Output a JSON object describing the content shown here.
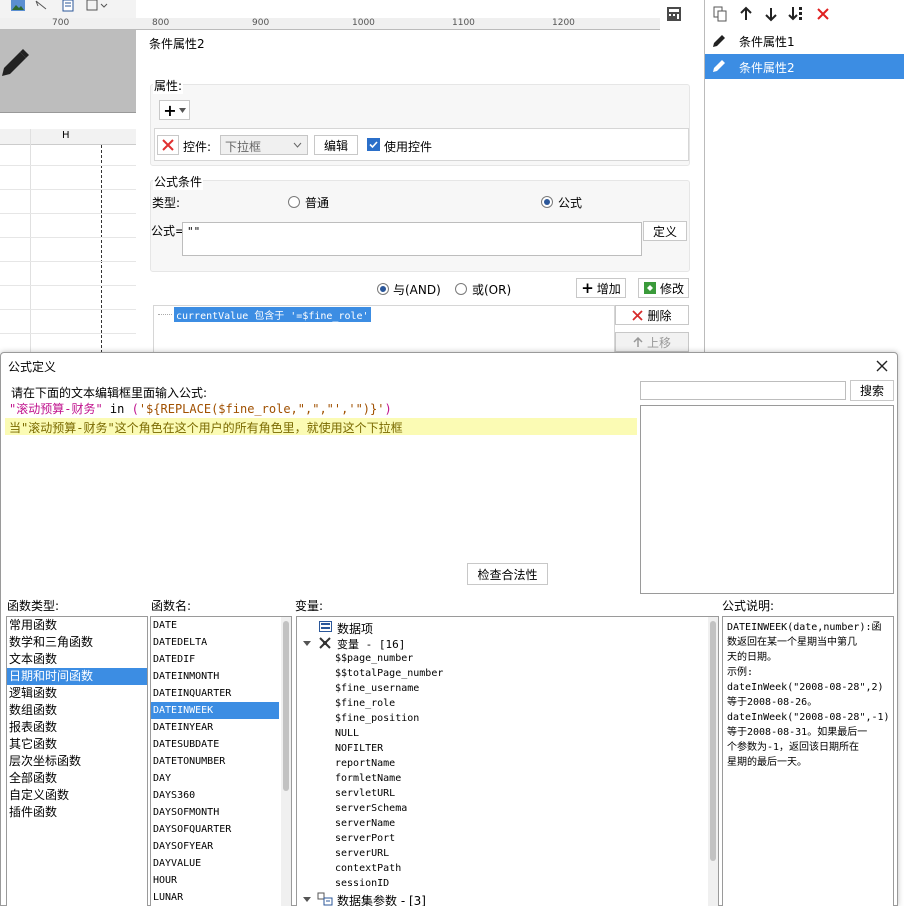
{
  "ruler": {
    "marks": [
      "700",
      "800",
      "900",
      "1000",
      "1100",
      "1200"
    ]
  },
  "sheet": {
    "column_h": "H"
  },
  "cond_panel": {
    "title": "条件属性2",
    "attr_section": "属性:",
    "add_plus": "+",
    "control_label": "控件:",
    "control_select": "下拉框",
    "edit_btn": "编辑",
    "use_control": "使用控件",
    "formula_section": "公式条件",
    "type_label": "类型:",
    "type_normal": "普通",
    "type_formula": "公式",
    "formula_label": "公式=",
    "formula_value": "\"\"",
    "define_btn": "定义",
    "and_label": "与(AND)",
    "or_label": "或(OR)",
    "add_btn": "增加",
    "modify_btn": "修改",
    "condition_item": "currentValue 包含于 '=$fine_role'",
    "delete_btn": "删除",
    "up_btn": "上移"
  },
  "right_panel": {
    "items": [
      "条件属性1",
      "条件属性2"
    ]
  },
  "dialog": {
    "title": "公式定义",
    "instruction": "请在下面的文本编辑框里面输入公式:",
    "line1_str": "\"滚动预算-财务\"",
    "line1_in": " in ",
    "line1_paren": "(",
    "line1_rest": "'${REPLACE($fine_role,\",\",\"','\")}'",
    "line1_close": ")",
    "line2": "当\"滚动预算-财务\"这个角色在这个用户的所有角色里，就使用这个下拉框",
    "search_placeholder": "",
    "search_btn": "搜索",
    "check_btn": "检查合法性",
    "func_type_label": "函数类型:",
    "func_types": [
      "常用函数",
      "数学和三角函数",
      "文本函数",
      "日期和时间函数",
      "逻辑函数",
      "数组函数",
      "报表函数",
      "其它函数",
      "层次坐标函数",
      "全部函数",
      "自定义函数",
      "插件函数"
    ],
    "func_name_label": "函数名:",
    "func_names": [
      "DATE",
      "DATEDELTA",
      "DATEDIF",
      "DATEINMONTH",
      "DATEINQUARTER",
      "DATEINWEEK",
      "DATEINYEAR",
      "DATESUBDATE",
      "DATETONUMBER",
      "DAY",
      "DAYS360",
      "DAYSOFMONTH",
      "DAYSOFQUARTER",
      "DAYSOFYEAR",
      "DAYVALUE",
      "HOUR",
      "LUNAR"
    ],
    "var_label": "变量:",
    "var_data_item": "数据项",
    "var_group": "变量 - [16]",
    "var_items": [
      "$$page_number",
      "$$totalPage_number",
      "$fine_username",
      "$fine_role",
      "$fine_position",
      "NULL",
      "NOFILTER",
      "reportName",
      "formletName",
      "servletURL",
      "serverSchema",
      "serverName",
      "serverPort",
      "serverURL",
      "contextPath",
      "sessionID"
    ],
    "var_dataset": "数据集参数 - [3]",
    "desc_label": "公式说明:",
    "desc_lines": [
      "DATEINWEEK(date,number):函",
      "数返回在某一个星期当中第几",
      "天的日期。",
      "示例:",
      "dateInWeek(\"2008-08-28\",2)",
      "等于2008-08-26。",
      "dateInWeek(\"2008-08-28\",-1)",
      "等于2008-08-31。如果最后一",
      "个参数为-1，返回该日期所在",
      "星期的最后一天。"
    ]
  }
}
